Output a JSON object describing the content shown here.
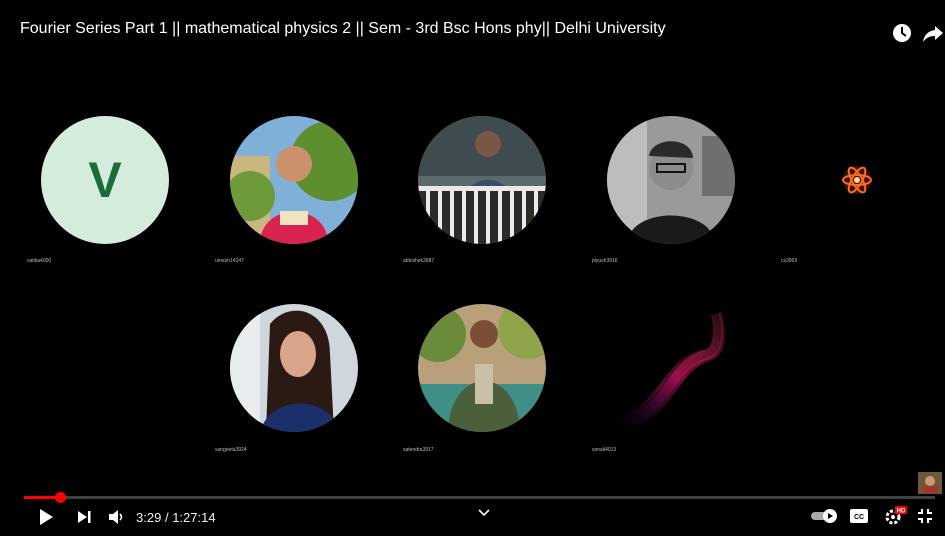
{
  "video": {
    "title": "Fourier Series Part 1 || mathematical physics 2 || Sem - 3rd Bsc Hons phy|| Delhi University",
    "current_time": "3:29",
    "duration": "1:27:14",
    "time_separator": "/",
    "progress_fraction": 0.04,
    "hd_badge": "HD",
    "cc_label": "CC"
  },
  "participants": [
    {
      "name": "vatika4000",
      "avatar_letter": "V"
    },
    {
      "name": "umesh14247"
    },
    {
      "name": "abhishek3987"
    },
    {
      "name": "piyush3916"
    },
    {
      "name": "cs3969"
    },
    {
      "name": "sangeeta3924"
    },
    {
      "name": "satendra3917"
    },
    {
      "name": "sonali4013"
    }
  ],
  "icons": [
    "clock-icon",
    "share-arrow-icon",
    "play-icon",
    "skip-next-icon",
    "volume-icon",
    "chevron-down-icon",
    "autoplay-toggle-icon",
    "captions-icon",
    "settings-gear-icon",
    "exit-fullscreen-icon"
  ],
  "colors": {
    "progress": "#ff0000",
    "background": "#000000",
    "letter_avatar_bg": "#d3ecdc",
    "letter_avatar_fg": "#1e6b3a"
  }
}
